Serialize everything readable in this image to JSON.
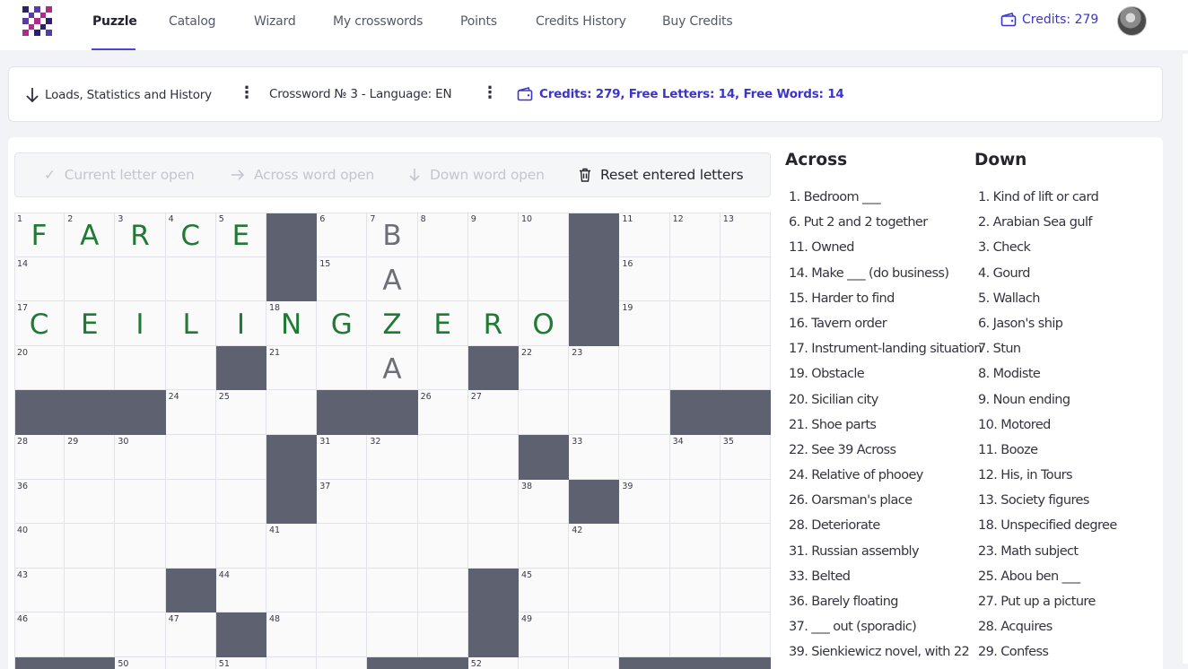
{
  "nav": {
    "items": [
      "Puzzle",
      "Catalog",
      "Wizard",
      "My crosswords",
      "Points",
      "Credits History",
      "Buy Credits"
    ],
    "active": "Puzzle",
    "credits_label": "Credits: 279"
  },
  "toolbar": {
    "loads_label": "Loads, Statistics and History",
    "crossword_label": "Crossword № 3 - Language: EN",
    "credits_label": "Credits: 279, Free Letters: 14, Free Words: 14"
  },
  "actions": {
    "current_letter": "Current letter open",
    "across_word": "Across word open",
    "down_word": "Down word open",
    "reset": "Reset entered letters"
  },
  "grid": {
    "columns": 15,
    "rows": [
      [
        {
          "n": "1",
          "l": "F",
          "c": "green"
        },
        {
          "n": "2",
          "l": "A",
          "c": "green"
        },
        {
          "n": "3",
          "l": "R",
          "c": "green"
        },
        {
          "n": "4",
          "l": "C",
          "c": "green"
        },
        {
          "n": "5",
          "l": "E",
          "c": "green"
        },
        {
          "b": true
        },
        {
          "n": "6"
        },
        {
          "n": "7",
          "l": "B",
          "c": "gray"
        },
        {
          "n": "8"
        },
        {
          "n": "9"
        },
        {
          "n": "10"
        },
        {
          "b": true
        },
        {
          "n": "11"
        },
        {
          "n": "12"
        },
        {
          "n": "13"
        }
      ],
      [
        {
          "n": "14"
        },
        {},
        {},
        {},
        {},
        {
          "b": true
        },
        {
          "n": "15"
        },
        {
          "l": "A",
          "c": "gray"
        },
        {},
        {},
        {},
        {
          "b": true
        },
        {
          "n": "16"
        },
        {},
        {}
      ],
      [
        {
          "n": "17",
          "l": "C",
          "c": "green"
        },
        {
          "l": "E",
          "c": "green"
        },
        {
          "l": "I",
          "c": "green"
        },
        {
          "l": "L",
          "c": "green"
        },
        {
          "l": "I",
          "c": "green"
        },
        {
          "n": "18",
          "l": "N",
          "c": "green"
        },
        {
          "l": "G",
          "c": "green"
        },
        {
          "l": "Z",
          "c": "green"
        },
        {
          "l": "E",
          "c": "green"
        },
        {
          "l": "R",
          "c": "green"
        },
        {
          "l": "O",
          "c": "green"
        },
        {
          "b": true
        },
        {
          "n": "19"
        },
        {},
        {}
      ],
      [
        {
          "n": "20"
        },
        {},
        {},
        {},
        {
          "b": true
        },
        {
          "n": "21"
        },
        {},
        {
          "l": "A",
          "c": "gray"
        },
        {},
        {
          "b": true
        },
        {
          "n": "22"
        },
        {
          "n": "23"
        },
        {},
        {},
        {}
      ],
      [
        {
          "b": true
        },
        {
          "b": true
        },
        {
          "b": true
        },
        {
          "n": "24"
        },
        {
          "n": "25"
        },
        {},
        {
          "b": true
        },
        {
          "b": true
        },
        {
          "n": "26"
        },
        {
          "n": "27"
        },
        {},
        {},
        {},
        {
          "b": true
        },
        {
          "b": true
        }
      ],
      [
        {
          "n": "28"
        },
        {
          "n": "29"
        },
        {
          "n": "30"
        },
        {},
        {},
        {
          "b": true
        },
        {
          "n": "31"
        },
        {
          "n": "32"
        },
        {},
        {},
        {
          "b": true
        },
        {
          "n": "33"
        },
        {},
        {
          "n": "34"
        },
        {
          "n": "35"
        }
      ],
      [
        {
          "n": "36"
        },
        {},
        {},
        {},
        {},
        {
          "b": true
        },
        {
          "n": "37"
        },
        {},
        {},
        {},
        {
          "n": "38"
        },
        {
          "b": true
        },
        {
          "n": "39"
        },
        {},
        {}
      ],
      [
        {
          "n": "40"
        },
        {},
        {},
        {},
        {},
        {
          "n": "41"
        },
        {},
        {},
        {},
        {},
        {},
        {
          "n": "42"
        },
        {},
        {},
        {}
      ],
      [
        {
          "n": "43"
        },
        {},
        {},
        {
          "b": true
        },
        {
          "n": "44"
        },
        {},
        {},
        {},
        {},
        {
          "b": true
        },
        {
          "n": "45"
        },
        {},
        {},
        {},
        {}
      ],
      [
        {
          "n": "46"
        },
        {},
        {},
        {
          "n": "47"
        },
        {
          "b": true
        },
        {
          "n": "48"
        },
        {},
        {},
        {},
        {
          "b": true
        },
        {
          "n": "49"
        },
        {},
        {},
        {},
        {}
      ],
      [
        {
          "b": true
        },
        {
          "b": true
        },
        {
          "n": "50"
        },
        {},
        {
          "n": "51"
        },
        {},
        {},
        {
          "b": true
        },
        {
          "b": true
        },
        {
          "n": "52"
        },
        {},
        {},
        {
          "b": true
        },
        {
          "b": true
        },
        {
          "b": true
        }
      ]
    ]
  },
  "clues": {
    "across_title": "Across",
    "down_title": "Down",
    "across": [
      "1. Bedroom ___",
      "6. Put 2 and 2 together",
      "11. Owned",
      "14. Make ___ (do business)",
      "15. Harder to find",
      "16. Tavern order",
      "17. Instrument-landing situation",
      "19. Obstacle",
      "20. Sicilian city",
      "21. Shoe parts",
      "22. See 39 Across",
      "24. Relative of phooey",
      "26. Oarsman's place",
      "28. Deteriorate",
      "31. Russian assembly",
      "33. Belted",
      "36. Barely floating",
      "37. ___ out (sporadic)",
      "39. Sienkiewicz novel, with 22"
    ],
    "down": [
      "1. Kind of lift or card",
      "2. Arabian Sea gulf",
      "3. Check",
      "4. Gourd",
      "5. Wallach",
      "6. Jason's ship",
      "7. Stun",
      "8. Modiste",
      "9. Noun ending",
      "10. Motored",
      "11. Booze",
      "12. His, in Tours",
      "13. Society figures",
      "18. Unspecified degree",
      "23. Math subject",
      "25. Abou ben ___",
      "27. Put up a picture",
      "28. Acquires",
      "29. Confess"
    ]
  },
  "colors": {
    "accent": "#3b36c9",
    "black_cell": "#5e616f",
    "letter_green": "#1f7a33",
    "letter_gray": "#6d6e78"
  },
  "icons": [
    "logo-icon",
    "wallet-icon",
    "arrow-down-icon",
    "kebab-icon",
    "check-icon",
    "arrow-right-icon",
    "trash-icon"
  ]
}
